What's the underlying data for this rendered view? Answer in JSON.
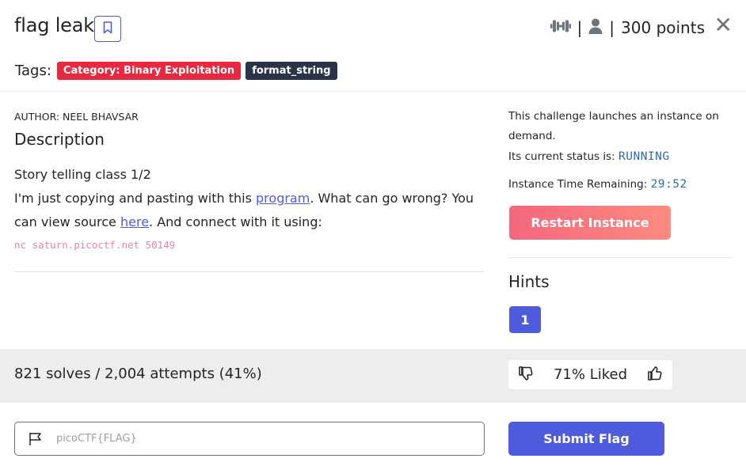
{
  "header": {
    "title": "flag leak",
    "difficulty_icon": "dumbbell-icon",
    "sep1": "|",
    "author_icon": "user-icon",
    "sep2": "|",
    "points": "300 points",
    "close": "✕"
  },
  "tags": {
    "label": "Tags:",
    "items": [
      "Category: Binary Exploitation",
      "format_string"
    ],
    "colors": {
      "category": "#e7283f",
      "format": "#2a3447"
    }
  },
  "description": {
    "author": "AUTHOR: NEEL BHAVSAR",
    "heading": "Description",
    "line1": "Story telling class 1/2",
    "line2_pre": "I'm just copying and pasting with this ",
    "line2_link": "program",
    "line2_post": ". What can go wrong? You can view source ",
    "line3_link": "here",
    "line3_post": ". And connect with it using:",
    "command": "nc saturn.picoctf.net 50149"
  },
  "instance": {
    "intro": "This challenge launches an instance on demand.",
    "status_label": "Its current status is:",
    "status_value": "RUNNING",
    "time_label": "Instance Time Remaining:",
    "time_value": "29:52",
    "restart_label": "Restart Instance"
  },
  "hints": {
    "heading": "Hints",
    "items": [
      "1"
    ]
  },
  "stats": {
    "solves": "821 solves / 2,004 attempts (41%)",
    "liked": "71% Liked"
  },
  "flag": {
    "placeholder": "picoCTF{FLAG}",
    "submit_label": "Submit Flag"
  },
  "colors": {
    "accent": "#4e5bdc",
    "restart_gradient": [
      "#f4677e",
      "#fc8b80"
    ],
    "band": "#ededee"
  }
}
